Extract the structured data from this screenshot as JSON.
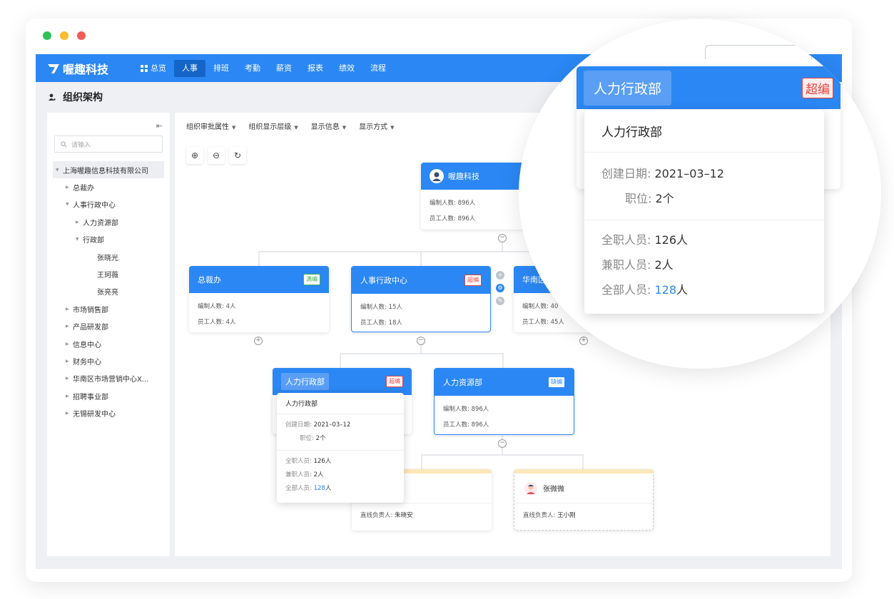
{
  "window": {
    "traffic_colors": [
      "#2fc15a",
      "#fbbd2d",
      "#ef5b57"
    ]
  },
  "nav": {
    "brand": "喔趣科技",
    "items": [
      {
        "label": "总览",
        "icon": "grid-icon"
      },
      {
        "label": "人事",
        "active": true
      },
      {
        "label": "排班"
      },
      {
        "label": "考勤"
      },
      {
        "label": "薪资"
      },
      {
        "label": "报表"
      },
      {
        "label": "绩效"
      },
      {
        "label": "流程"
      }
    ]
  },
  "page": {
    "title": "组织架构"
  },
  "sidebar": {
    "search_placeholder": "请输入",
    "tree": [
      {
        "label": "上海喔趣信息科技有限公司",
        "level": 0,
        "caret": "▼",
        "selected": true
      },
      {
        "label": "总裁办",
        "level": 1,
        "caret": "▶"
      },
      {
        "label": "人事行政中心",
        "level": 1,
        "caret": "▼"
      },
      {
        "label": "人力资源部",
        "level": 2,
        "caret": "▶"
      },
      {
        "label": "行政部",
        "level": 2,
        "caret": "▼"
      },
      {
        "label": "张晓光",
        "level": 3,
        "caret": ""
      },
      {
        "label": "王珂薇",
        "level": 3,
        "caret": ""
      },
      {
        "label": "张亮亮",
        "level": 3,
        "caret": ""
      },
      {
        "label": "市场销售部",
        "level": 1,
        "caret": "▶"
      },
      {
        "label": "产品研发部",
        "level": 1,
        "caret": "▶"
      },
      {
        "label": "信息中心",
        "level": 1,
        "caret": "▶"
      },
      {
        "label": "财务中心",
        "level": 1,
        "caret": "▶"
      },
      {
        "label": "华南区市场营销中心X...",
        "level": 1,
        "caret": "▶"
      },
      {
        "label": "招聘事业部",
        "level": 1,
        "caret": "▶"
      },
      {
        "label": "无锡研发中心",
        "level": 1,
        "caret": "▶"
      }
    ]
  },
  "toolbar": {
    "items": [
      "组织审批属性",
      "组织显示层级",
      "显示信息",
      "显示方式"
    ]
  },
  "zoom": {
    "in": "⊕",
    "out": "⊖",
    "reset": "↻"
  },
  "labels": {
    "planned": "编制人数: ",
    "staff": "员工人数: ",
    "manager": "直线负责人: "
  },
  "org": {
    "root": {
      "name": "喔趣科技",
      "planned": "896人",
      "staff": "896人"
    },
    "zongcaiban": {
      "name": "总裁办",
      "badge": "满编",
      "planned": "4人",
      "staff": "4人"
    },
    "renshi": {
      "name": "人事行政中心",
      "badge": "超编",
      "planned": "15人",
      "staff": "18人"
    },
    "huanan": {
      "name": "华南区",
      "planned": "40",
      "staff": "45人"
    },
    "xingzheng": {
      "name": "人力行政部",
      "badge": "超编"
    },
    "renli": {
      "name": "人力资源部",
      "badge": "缺编",
      "planned": "896人",
      "staff": "896人"
    },
    "person1": {
      "name": "",
      "manager": "朱晓安"
    },
    "person2": {
      "name": "张微微",
      "manager": "王小刚"
    }
  },
  "popover": {
    "title": "人力行政部",
    "created_label": "创建日期: ",
    "created_value": "2021–03–12",
    "position_label": "职位: ",
    "position_value": "2个",
    "fulltime_label": "全职人员: ",
    "fulltime_value": "126人",
    "parttime_label": "兼职人员: ",
    "parttime_value": "2人",
    "total_label": "全部人员: ",
    "total_value": "128",
    "total_unit": "人"
  },
  "colors": {
    "primary": "#2b87f3",
    "over": "#e8423e",
    "full": "#3fb34f"
  }
}
